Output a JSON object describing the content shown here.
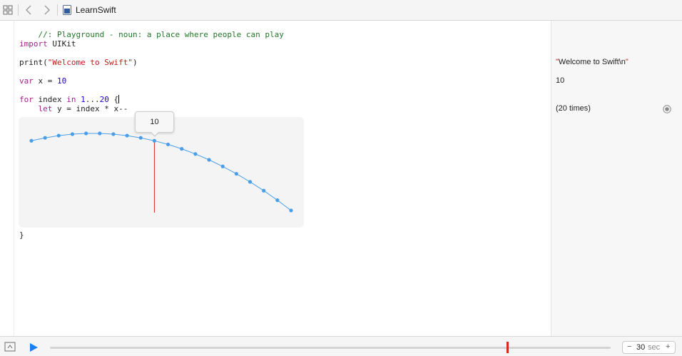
{
  "toolbar": {
    "file_name": "LearnSwift",
    "icons": [
      "grid-icon",
      "back-arrow-icon",
      "forward-arrow-icon",
      "swift-file-icon"
    ]
  },
  "code": {
    "line1_comment": "//: Playground - noun: a place where people can play",
    "line2_kw": "import",
    "line2_rest": " UIKit",
    "line3_fn": "print(",
    "line3_str": "\"Welcome to Swift\"",
    "line3_end": ")",
    "line4_kw": "var",
    "line4_mid": " x = ",
    "line4_num": "10",
    "line5_kw": "for",
    "line5_a": " index ",
    "line5_kw2": "in",
    "line5_b": " ",
    "line5_num1": "1",
    "line5_c": "...",
    "line5_num2": "20",
    "line5_d": " {",
    "line6_pre": "    ",
    "line6_kw": "let",
    "line6_rest": " y = index * x--",
    "line7_close": "}"
  },
  "results": {
    "r1_quote_open": "\"",
    "r1_text": "Welcome to Swift\\n",
    "r1_quote_close": "\"",
    "r2": "10",
    "r3": "(20 times)"
  },
  "graph": {
    "tooltip_value": "10",
    "marker_index": 10,
    "line_color": "#4a9ee8",
    "marker_color": "#d42a20"
  },
  "chart_data": {
    "type": "line",
    "x": [
      1,
      2,
      3,
      4,
      5,
      6,
      7,
      8,
      9,
      10,
      11,
      12,
      13,
      14,
      15,
      16,
      17,
      18,
      19,
      20
    ],
    "values": [
      10,
      18,
      24,
      28,
      30,
      30,
      28,
      24,
      18,
      10,
      0,
      -12,
      -26,
      -42,
      -60,
      -80,
      -102,
      -126,
      -152,
      -180
    ]
  },
  "timeline": {
    "duration_value": "30",
    "duration_unit": "sec",
    "minus": "−",
    "plus": "+",
    "playhead_fraction": 0.816,
    "accent_color": "#1a7ff5"
  }
}
